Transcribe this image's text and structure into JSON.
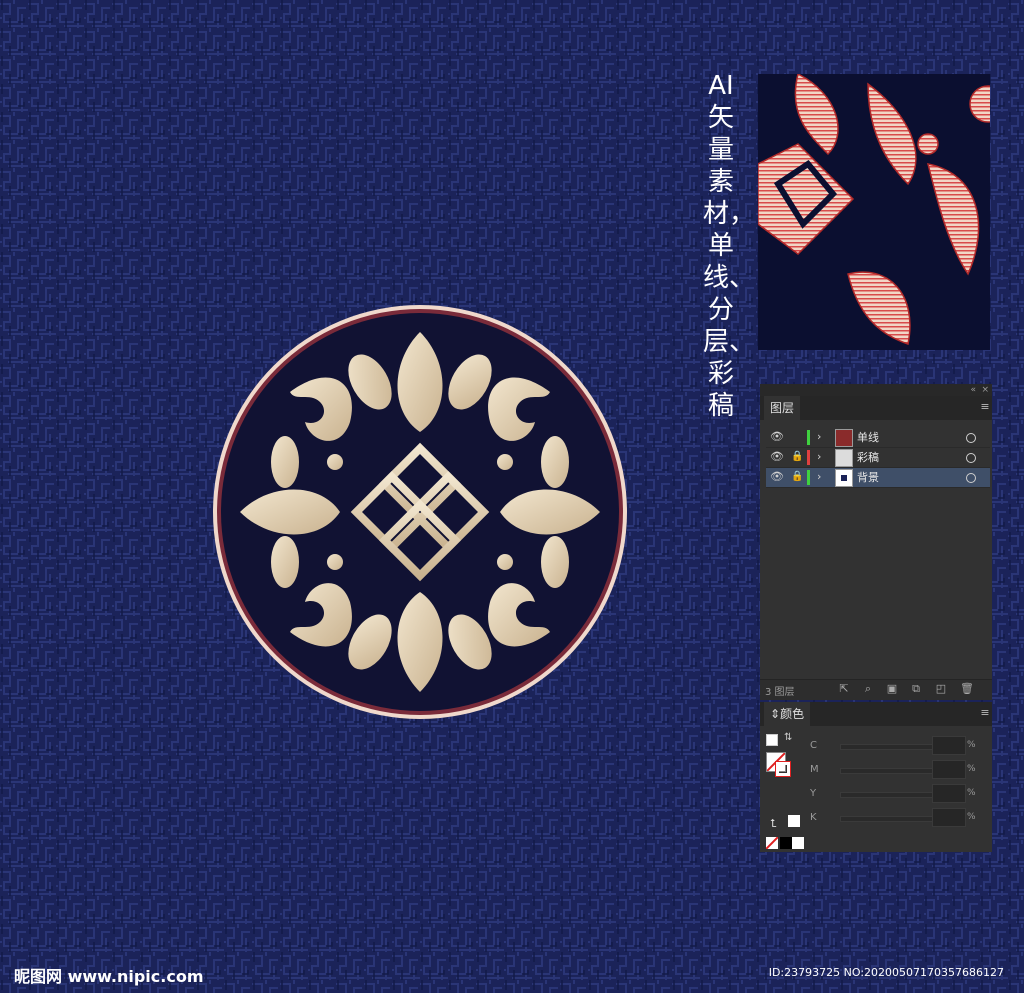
{
  "background_color": "#1a2257",
  "title_vertical": "AI矢量素材，单线、分层、彩稿",
  "layers_panel": {
    "tab_label": "图层",
    "collapse_icon": "double-chevron-icon",
    "layers": [
      {
        "name": "单线",
        "color": "#3fd13f",
        "locked": false,
        "selected": false
      },
      {
        "name": "彩稿",
        "color": "#e04040",
        "locked": true,
        "selected": false
      },
      {
        "name": "背景",
        "color": "#3fd13f",
        "locked": true,
        "selected": true
      }
    ],
    "count_label": "3 图层"
  },
  "color_panel": {
    "tab_label": "颜色",
    "channels": [
      "C",
      "M",
      "Y",
      "K"
    ],
    "percent": "%"
  },
  "watermark": {
    "site": "昵图网 www.nipic.com",
    "id_text": "ID:23793725 NO:20200507170357686127"
  }
}
